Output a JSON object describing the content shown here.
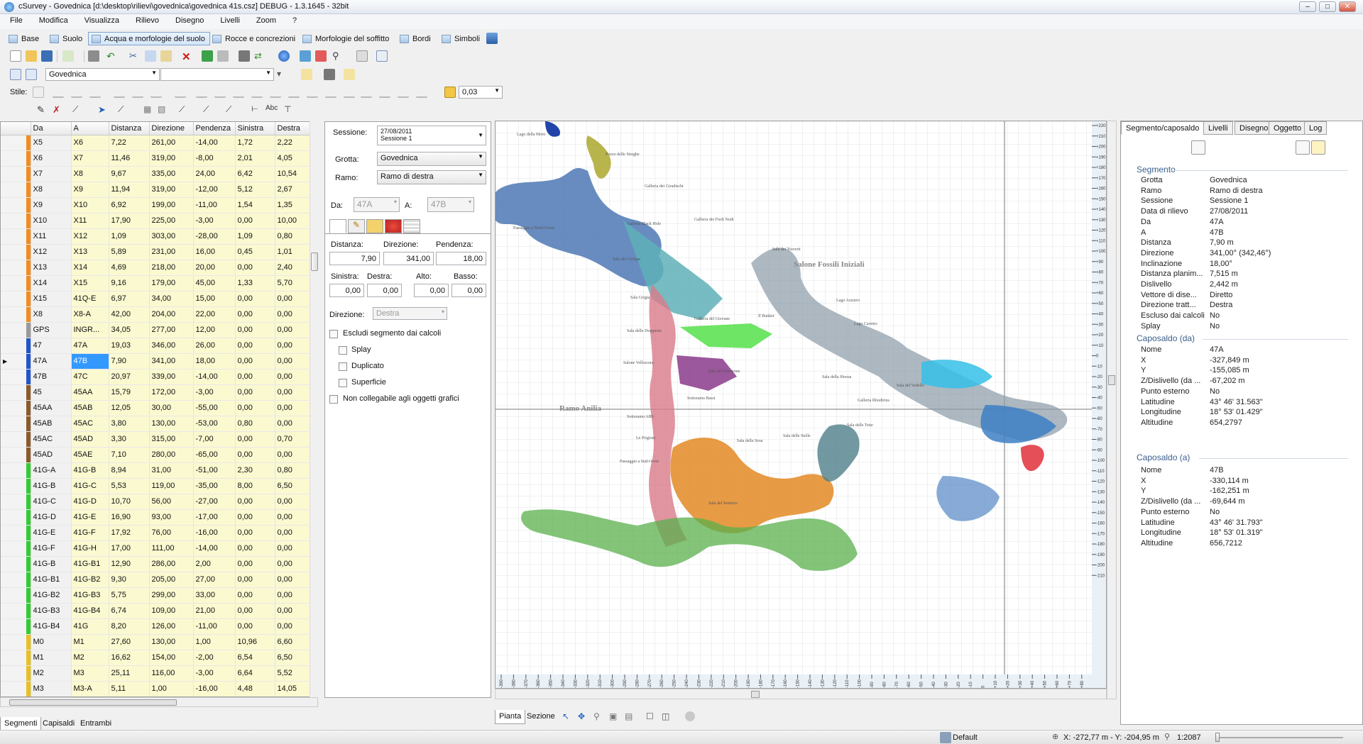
{
  "window": {
    "title": "cSurvey - Govednica [d:\\desktop\\rilievi\\govednica\\govednica 41s.csz] DEBUG - 1.3.1645 - 32bit"
  },
  "menu": [
    "File",
    "Modifica",
    "Visualizza",
    "Rilievo",
    "Disegno",
    "Livelli",
    "Zoom",
    "?"
  ],
  "layers": [
    "Base",
    "Suolo",
    "Acqua e morfologie del suolo",
    "Rocce e concrezioni",
    "Morfologie del soffitto",
    "Bordi",
    "Simboli"
  ],
  "toolbar": {
    "cave_combo": "Govednica",
    "style_label": "Stile:",
    "line_width": "0,03"
  },
  "grid": {
    "columns": [
      "Da",
      "A",
      "Distanza",
      "Direzione",
      "Pendenza",
      "Sinistra",
      "Destra"
    ],
    "rows": [
      [
        "X5",
        "X6",
        "7,22",
        "261,00",
        "-14,00",
        "1,72",
        "2,22"
      ],
      [
        "X6",
        "X7",
        "11,46",
        "319,00",
        "-8,00",
        "2,01",
        "4,05"
      ],
      [
        "X7",
        "X8",
        "9,67",
        "335,00",
        "24,00",
        "6,42",
        "10,54"
      ],
      [
        "X8",
        "X9",
        "11,94",
        "319,00",
        "-12,00",
        "5,12",
        "2,67"
      ],
      [
        "X9",
        "X10",
        "6,92",
        "199,00",
        "-11,00",
        "1,54",
        "1,35"
      ],
      [
        "X10",
        "X11",
        "17,90",
        "225,00",
        "-3,00",
        "0,00",
        "10,00"
      ],
      [
        "X11",
        "X12",
        "1,09",
        "303,00",
        "-28,00",
        "1,09",
        "0,80"
      ],
      [
        "X12",
        "X13",
        "5,89",
        "231,00",
        "16,00",
        "0,45",
        "1,01"
      ],
      [
        "X13",
        "X14",
        "4,69",
        "218,00",
        "20,00",
        "0,00",
        "2,40"
      ],
      [
        "X14",
        "X15",
        "9,16",
        "179,00",
        "45,00",
        "1,33",
        "5,70"
      ],
      [
        "X15",
        "41Q-E",
        "6,97",
        "34,00",
        "15,00",
        "0,00",
        "0,00"
      ],
      [
        "X8",
        "X8-A",
        "42,00",
        "204,00",
        "22,00",
        "0,00",
        "0,00"
      ],
      [
        "GPS",
        "INGR...",
        "34,05",
        "277,00",
        "12,00",
        "0,00",
        "0,00"
      ],
      [
        "47",
        "47A",
        "19,03",
        "346,00",
        "26,00",
        "0,00",
        "0,00"
      ],
      [
        "47A",
        "47B",
        "7,90",
        "341,00",
        "18,00",
        "0,00",
        "0,00"
      ],
      [
        "47B",
        "47C",
        "20,97",
        "339,00",
        "-14,00",
        "0,00",
        "0,00"
      ],
      [
        "45",
        "45AA",
        "15,79",
        "172,00",
        "-3,00",
        "0,00",
        "0,00"
      ],
      [
        "45AA",
        "45AB",
        "12,05",
        "30,00",
        "-55,00",
        "0,00",
        "0,00"
      ],
      [
        "45AB",
        "45AC",
        "3,80",
        "130,00",
        "-53,00",
        "0,80",
        "0,00"
      ],
      [
        "45AC",
        "45AD",
        "3,30",
        "315,00",
        "-7,00",
        "0,00",
        "0,70"
      ],
      [
        "45AD",
        "45AE",
        "7,10",
        "280,00",
        "-65,00",
        "0,00",
        "0,00"
      ],
      [
        "41G-A",
        "41G-B",
        "8,94",
        "31,00",
        "-51,00",
        "2,30",
        "0,80"
      ],
      [
        "41G-B",
        "41G-C",
        "5,53",
        "119,00",
        "-35,00",
        "8,00",
        "6,50"
      ],
      [
        "41G-C",
        "41G-D",
        "10,70",
        "56,00",
        "-27,00",
        "0,00",
        "0,00"
      ],
      [
        "41G-D",
        "41G-E",
        "16,90",
        "93,00",
        "-17,00",
        "0,00",
        "0,00"
      ],
      [
        "41G-E",
        "41G-F",
        "17,92",
        "76,00",
        "-16,00",
        "0,00",
        "0,00"
      ],
      [
        "41G-F",
        "41G-H",
        "17,00",
        "111,00",
        "-14,00",
        "0,00",
        "0,00"
      ],
      [
        "41G-B",
        "41G-B1",
        "12,90",
        "286,00",
        "2,00",
        "0,00",
        "0,00"
      ],
      [
        "41G-B1",
        "41G-B2",
        "9,30",
        "205,00",
        "27,00",
        "0,00",
        "0,00"
      ],
      [
        "41G-B2",
        "41G-B3",
        "5,75",
        "299,00",
        "33,00",
        "0,00",
        "0,00"
      ],
      [
        "41G-B3",
        "41G-B4",
        "6,74",
        "109,00",
        "21,00",
        "0,00",
        "0,00"
      ],
      [
        "41G-B4",
        "41G",
        "8,20",
        "126,00",
        "-11,00",
        "0,00",
        "0,00"
      ],
      [
        "M0",
        "M1",
        "27,60",
        "130,00",
        "1,00",
        "10,96",
        "6,60"
      ],
      [
        "M1",
        "M2",
        "16,62",
        "154,00",
        "-2,00",
        "6,54",
        "6,50"
      ],
      [
        "M2",
        "M3",
        "25,11",
        "116,00",
        "-3,00",
        "6,64",
        "5,52"
      ],
      [
        "M3",
        "M3-A",
        "5,11",
        "1,00",
        "-16,00",
        "4,48",
        "14,05"
      ]
    ],
    "row_colors": [
      "#f28c1e",
      "#f28c1e",
      "#f28c1e",
      "#f28c1e",
      "#f28c1e",
      "#f28c1e",
      "#f28c1e",
      "#f28c1e",
      "#f28c1e",
      "#f28c1e",
      "#f28c1e",
      "#f28c1e",
      "#9a9a9a",
      "#2255cc",
      "#2255cc",
      "#2255cc",
      "#8b5a2b",
      "#8b5a2b",
      "#8b5a2b",
      "#8b5a2b",
      "#8b5a2b",
      "#33cc33",
      "#33cc33",
      "#33cc33",
      "#33cc33",
      "#33cc33",
      "#33cc33",
      "#33cc33",
      "#33cc33",
      "#33cc33",
      "#33cc33",
      "#33cc33",
      "#e8c020",
      "#e8c020",
      "#e8c020",
      "#e8c020"
    ],
    "selected_row": 14
  },
  "bottom_tabs": [
    "Segmenti",
    "Capisaldi",
    "Entrambi"
  ],
  "editor": {
    "session_label": "Sessione:",
    "session_date": "27/08/2011",
    "session_name": "Sessione 1",
    "cave_label": "Grotta:",
    "cave_value": "Govednica",
    "branch_label": "Ramo:",
    "branch_value": "Ramo di destra",
    "from_label": "Da:",
    "from_value": "47A",
    "to_label": "A:",
    "to_value": "47B",
    "distance_label": "Distanza:",
    "direction_label": "Direzione:",
    "slope_label": "Pendenza:",
    "distance": "7,90",
    "direction": "341,00",
    "slope": "18,00",
    "left_label": "Sinistra:",
    "right_label": "Destra:",
    "up_label": "Alto:",
    "down_label": "Basso:",
    "left": "0,00",
    "right": "0,00",
    "up": "0,00",
    "down": "0,00",
    "dir_label": "Direzione:",
    "dir_value": "Destra",
    "exclude_label": "Escludi segmento dai calcoli",
    "splay_label": "Splay",
    "duplicate_label": "Duplicato",
    "surface_label": "Superficie",
    "not_linkable_label": "Non collegabile agli oggetti grafici"
  },
  "map": {
    "labels": [
      "Lago della Moro",
      "Pozzo delle Streghe",
      "Galleria dei Giradischi",
      "Galleria dei Fiedi Nudi",
      "Passaggio a Nord-Ovest",
      "Galleria Black Hole",
      "Sala dei Ciclope",
      "Salone Fossili Iniziali",
      "Sala Grigia",
      "Sala dei Traverti",
      "Galleria del Giovane",
      "Il Bunker",
      "Sala delle Drapperie",
      "Lago Azzurro",
      "Lago Carento",
      "Sala della Sborsa",
      "Salone Vellescura",
      "Sala del Penetrone",
      "Ramo Anilia",
      "Sottoramo Bassi",
      "Sottoramo ABS",
      "Le Prigioni",
      "Sala della Sosa",
      "Sala delle Stelle",
      "Passaggio a Sud-Ovest",
      "Sala delle Tette",
      "Galleria Rhodirrea",
      "Sala del Vedello",
      "Sala del Sentiero"
    ],
    "vruler_ticks": [
      "+220",
      "+210",
      "+200",
      "+190",
      "+180",
      "+170",
      "+160",
      "+150",
      "+140",
      "+130",
      "+120",
      "+110",
      "+100",
      "+90",
      "+80",
      "+70",
      "+60",
      "+50",
      "+40",
      "+30",
      "+20",
      "+10",
      "0",
      "-10",
      "-20",
      "-30",
      "-40",
      "-50",
      "-60",
      "-70",
      "-80",
      "-90",
      "-100",
      "-110",
      "-120",
      "-130",
      "-140",
      "-150",
      "-160",
      "-170",
      "-180",
      "-190",
      "-200",
      "-210"
    ],
    "hruler_ticks": [
      "-390",
      "-380",
      "-370",
      "-360",
      "-350",
      "-340",
      "-330",
      "-320",
      "-310",
      "-300",
      "-290",
      "-280",
      "-270",
      "-260",
      "-250",
      "-240",
      "-230",
      "-220",
      "-210",
      "-200",
      "-190",
      "-180",
      "-170",
      "-160",
      "-150",
      "-140",
      "-130",
      "-120",
      "-110",
      "-100",
      "-90",
      "-80",
      "-70",
      "-60",
      "-50",
      "-40",
      "-30",
      "-20",
      "-10",
      "0",
      "+10",
      "+20",
      "+30",
      "+40",
      "+50",
      "+60",
      "+70",
      "+80"
    ]
  },
  "map_tabs": [
    "Pianta",
    "Sezione"
  ],
  "properties": {
    "tabs": [
      "Segmento/caposaldo",
      "Livelli",
      "Disegno",
      "Oggetto",
      "Log"
    ],
    "segment_title": "Segmento",
    "segment": [
      [
        "Grotta",
        "Govednica"
      ],
      [
        "Ramo",
        "Ramo di destra"
      ],
      [
        "Sessione",
        "Sessione 1"
      ],
      [
        "Data di rilievo",
        "27/08/2011"
      ],
      [
        "Da",
        "47A"
      ],
      [
        "A",
        "47B"
      ],
      [
        "Distanza",
        "7,90 m"
      ],
      [
        "Direzione",
        "341,00° (342,46°)"
      ],
      [
        "Inclinazione",
        "18,00°"
      ],
      [
        "Distanza planim...",
        "7,515 m"
      ],
      [
        "Dislivello",
        "2,442 m"
      ],
      [
        "Vettore di dise...",
        "Diretto"
      ],
      [
        "Direzione tratt...",
        "Destra"
      ],
      [
        "Escluso dai calcoli",
        "No"
      ],
      [
        "Splay",
        "No"
      ]
    ],
    "from_title": "Caposaldo (da)",
    "from": [
      [
        "Nome",
        "47A"
      ],
      [
        "X",
        "-327,849 m"
      ],
      [
        "Y",
        "-155,085 m"
      ],
      [
        "Z/Dislivello (da ...",
        "-67,202 m"
      ],
      [
        "Punto esterno",
        "No"
      ],
      [
        "Latitudine",
        "43° 46' 31.563\""
      ],
      [
        "Longitudine",
        "18° 53' 01.429\""
      ],
      [
        "Altitudine",
        "654,2797"
      ]
    ],
    "to_title": "Caposaldo (a)",
    "to": [
      [
        "Nome",
        "47B"
      ],
      [
        "X",
        "-330,114 m"
      ],
      [
        "Y",
        "-162,251 m"
      ],
      [
        "Z/Dislivello (da ...",
        "-69,644 m"
      ],
      [
        "Punto esterno",
        "No"
      ],
      [
        "Latitudine",
        "43° 46' 31.793\""
      ],
      [
        "Longitudine",
        "18° 53' 01.319\""
      ],
      [
        "Altitudine",
        "656,7212"
      ]
    ]
  },
  "status": {
    "profile": "Default",
    "coords": "X: -272,77 m - Y: -204,95 m",
    "scale": "1:2087"
  }
}
